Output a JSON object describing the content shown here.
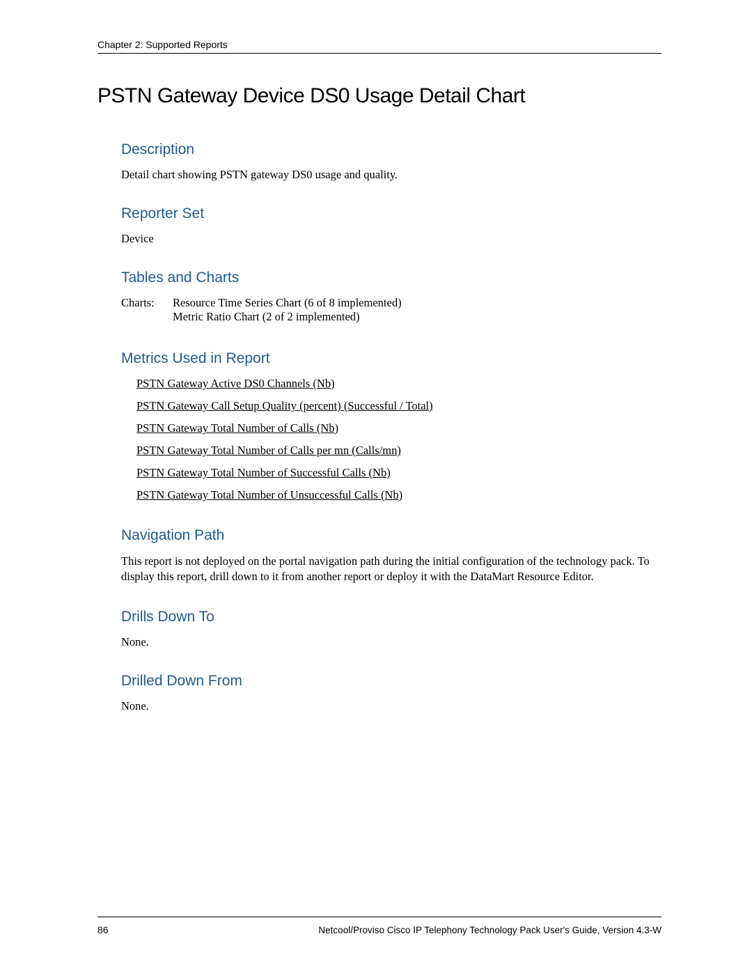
{
  "header": {
    "chapter": "Chapter 2: Supported Reports"
  },
  "title": "PSTN Gateway Device DS0 Usage Detail Chart",
  "sections": {
    "description": {
      "heading": "Description",
      "text": "Detail chart showing PSTN gateway DS0 usage and quality."
    },
    "reporterSet": {
      "heading": "Reporter Set",
      "text": "Device"
    },
    "tablesAndCharts": {
      "heading": "Tables and Charts",
      "label": "Charts:",
      "line1": "Resource Time Series Chart (6 of 8 implemented)",
      "line2": "Metric Ratio Chart (2 of 2 implemented)"
    },
    "metricsUsed": {
      "heading": "Metrics Used in Report",
      "items": [
        "PSTN Gateway Active DS0 Channels (Nb)",
        "PSTN Gateway Call Setup Quality (percent) (Successful /  Total)",
        "PSTN Gateway Total Number of Calls (Nb)",
        "PSTN Gateway Total Number of Calls per mn (Calls/mn)",
        "PSTN Gateway Total Number of Successful Calls (Nb)",
        "PSTN Gateway Total Number of Unsuccessful Calls (Nb)"
      ]
    },
    "navigationPath": {
      "heading": "Navigation Path",
      "text": "This report is not deployed on the portal navigation path during the initial configuration of the technology pack. To display this report, drill down to it from another report or deploy it with the DataMart Resource Editor."
    },
    "drillsDownTo": {
      "heading": "Drills Down To",
      "text": "None."
    },
    "drilledDownFrom": {
      "heading": "Drilled Down From",
      "text": "None."
    }
  },
  "footer": {
    "pageNumber": "86",
    "text": "Netcool/Proviso Cisco IP Telephony Technology Pack User's Guide, Version 4.3-W"
  }
}
